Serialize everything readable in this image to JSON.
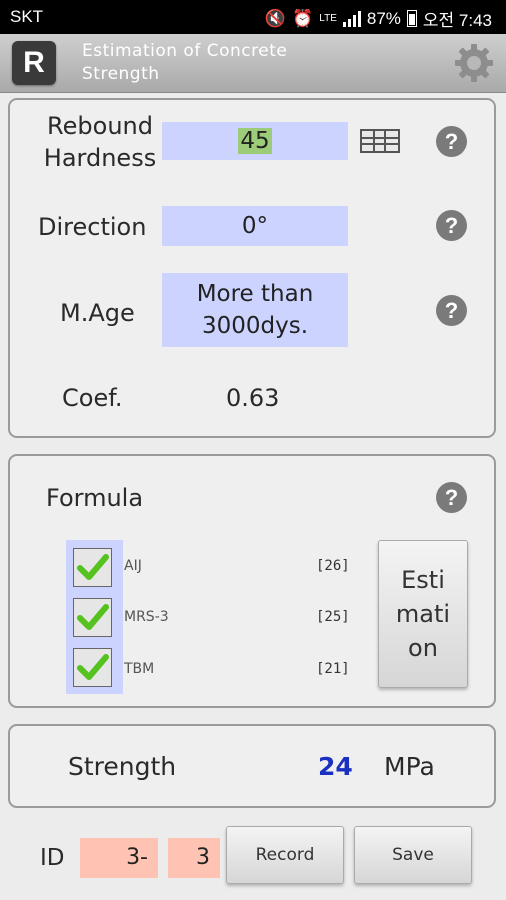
{
  "status_bar": {
    "carrier": "SKT",
    "right_text": "87%",
    "time": "오전 7:43",
    "network": "LTE"
  },
  "app_bar": {
    "icon_letter": "R",
    "title_line1": "Estimation of Concrete",
    "title_line2": "Strength"
  },
  "input_panel": {
    "rebound_label_line1": "Rebound",
    "rebound_label_line2": "Hardness",
    "rebound_value": "45",
    "direction_label": "Direction",
    "direction_value": "0°",
    "age_label": "M.Age",
    "age_value_line1": "More than",
    "age_value_line2": "3000dys.",
    "coef_label": "Coef.",
    "coef_value": "0.63",
    "help_glyph": "?"
  },
  "formula_panel": {
    "title": "Formula",
    "items": [
      {
        "name": "AIJ",
        "value": "[26]",
        "checked": true
      },
      {
        "name": "MRS-3",
        "value": "[25]",
        "checked": true
      },
      {
        "name": "TBM",
        "value": "[21]",
        "checked": true
      }
    ],
    "estimation_line1": "Esti",
    "estimation_line2": "mati",
    "estimation_line3": "on"
  },
  "result_panel": {
    "label": "Strength",
    "value": "24",
    "unit": "MPa"
  },
  "footer": {
    "id_label": "ID",
    "id_part1": "3-",
    "id_part2": "3",
    "record_label": "Record",
    "save_label": "Save"
  },
  "colors": {
    "field_blue": "#ccd3ff",
    "field_salmon": "#ffc3b3",
    "value_green": "#9ccc7a",
    "result_blue": "#1a30c0",
    "check_green": "#55c21f"
  }
}
